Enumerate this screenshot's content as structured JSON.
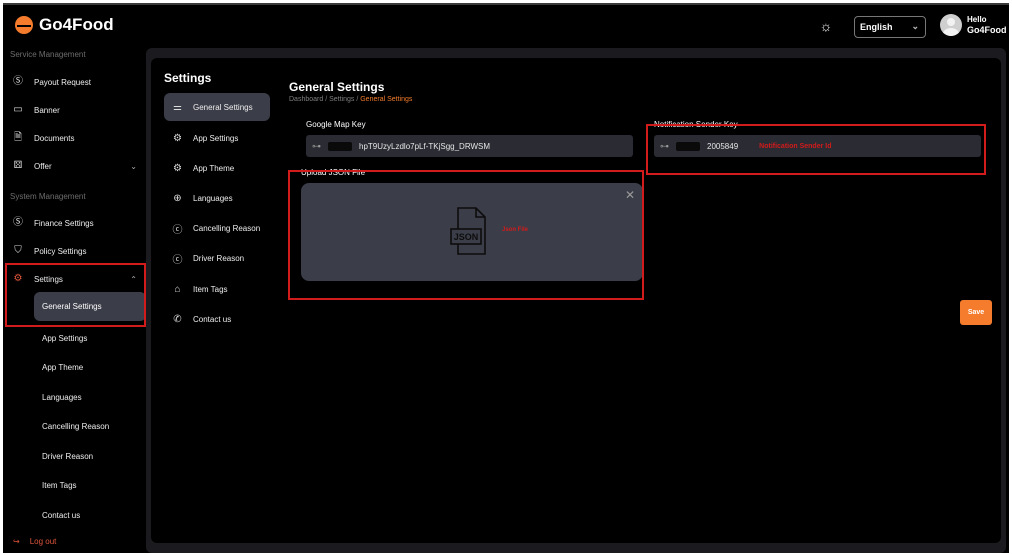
{
  "app": {
    "name": "Go4Food"
  },
  "header": {
    "language": "English",
    "greeting": "Hello",
    "user_name": "Go4Food"
  },
  "sidebar": {
    "service_title": "Service Management",
    "system_title": "System Management",
    "service_items": [
      {
        "label": "Payout Request",
        "icon": "dollar-circle-icon"
      },
      {
        "label": "Banner",
        "icon": "banner-icon"
      },
      {
        "label": "Documents",
        "icon": "document-icon"
      },
      {
        "label": "Offer",
        "icon": "offer-icon"
      }
    ],
    "system_items": [
      {
        "label": "Finance Settings",
        "icon": "dollar-circle-icon"
      },
      {
        "label": "Policy Settings",
        "icon": "shield-icon"
      },
      {
        "label": "Settings",
        "icon": "gear-icon"
      }
    ],
    "settings_sub": [
      "General Settings",
      "App Settings",
      "App Theme",
      "Languages",
      "Cancelling Reason",
      "Driver Reason",
      "Item Tags",
      "Contact us"
    ],
    "logout": "Log out"
  },
  "settings_nav": {
    "title": "Settings",
    "items": [
      {
        "label": "General Settings",
        "icon": "sliders-icon"
      },
      {
        "label": "App Settings",
        "icon": "gear-icon"
      },
      {
        "label": "App Theme",
        "icon": "gear-icon"
      },
      {
        "label": "Languages",
        "icon": "globe-icon"
      },
      {
        "label": "Cancelling Reason",
        "icon": "reason-icon"
      },
      {
        "label": "Driver Reason",
        "icon": "reason-icon"
      },
      {
        "label": "Item Tags",
        "icon": "tag-icon"
      },
      {
        "label": "Contact us",
        "icon": "phone-icon"
      }
    ]
  },
  "main": {
    "title": "General Settings",
    "breadcrumb": {
      "home": "Dashboard",
      "parent": "Settings",
      "current": "General Settings"
    },
    "google_map_key": {
      "label": "Google Map Key",
      "value": "hpT9UzyLzdlo7pLf-TKjSgg_DRWSM"
    },
    "notification_key": {
      "label": "Notification Sender Key",
      "value": "2005849",
      "hint": "Notification Sender Id"
    },
    "upload": {
      "label": "Upload JSON File",
      "hint": "Json File",
      "icon_text": "JSON"
    },
    "save": "Save"
  },
  "colors": {
    "accent": "#f47c2c",
    "annotation": "#d21b1b",
    "active_bg": "#3b3d48"
  }
}
